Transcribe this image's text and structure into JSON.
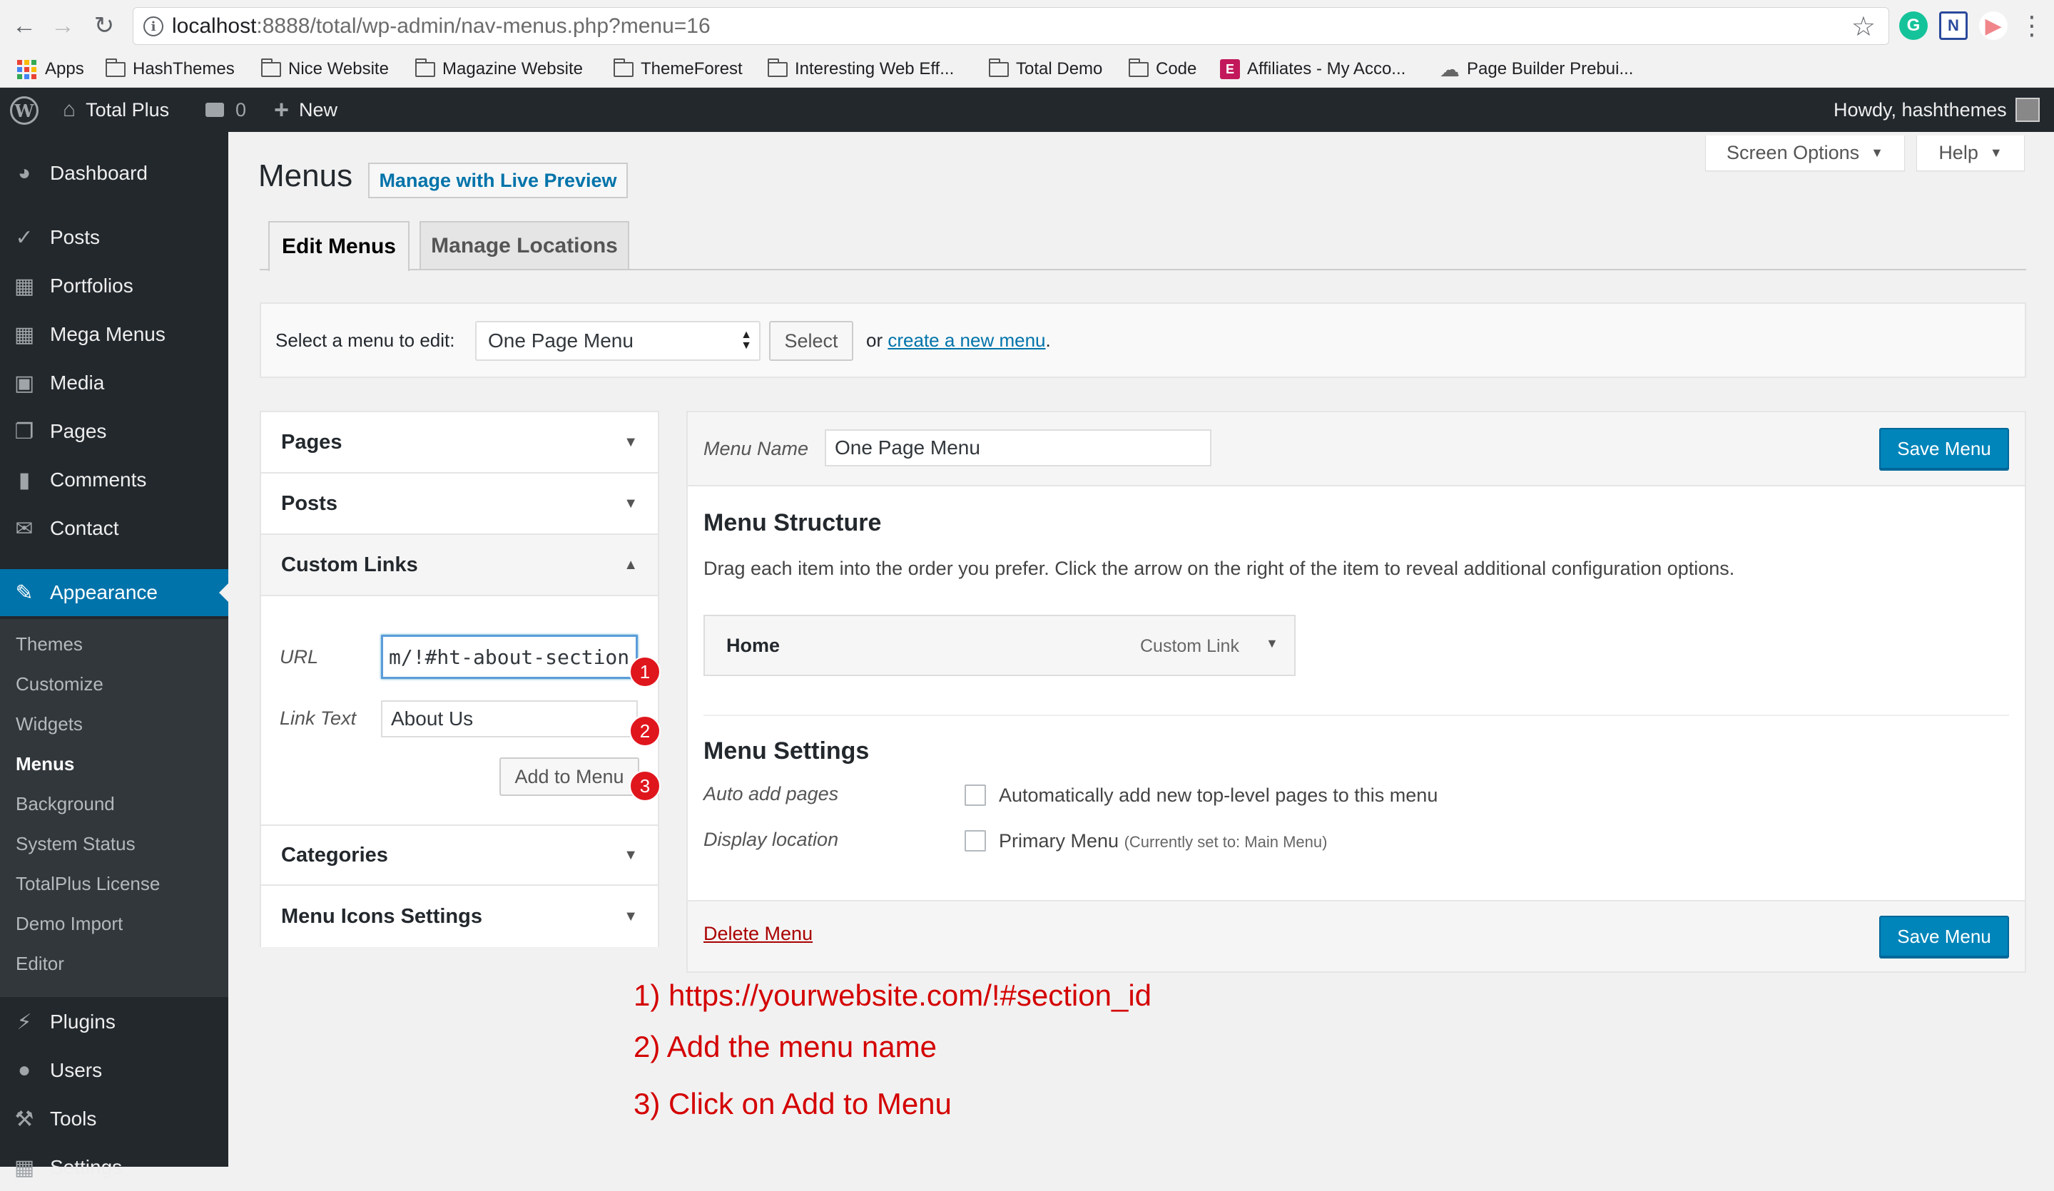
{
  "browser": {
    "url_host": "localhost",
    "url_rest": ":8888/total/wp-admin/nav-menus.php?menu=16",
    "bookmarks": [
      "Apps",
      "HashThemes",
      "Nice Website",
      "Magazine Website",
      "ThemeForest",
      "Interesting Web Eff...",
      "Total Demo",
      "Code",
      "Affiliates - My Acco...",
      "Page Builder Prebui..."
    ]
  },
  "adminbar": {
    "site_name": "Total Plus",
    "comments_count": "0",
    "new_label": "New",
    "howdy": "Howdy, hashthemes"
  },
  "sidebar": {
    "items": [
      "Dashboard",
      "Posts",
      "Portfolios",
      "Mega Menus",
      "Media",
      "Pages",
      "Comments",
      "Contact",
      "Appearance",
      "Plugins",
      "Users",
      "Tools",
      "Settings"
    ],
    "submenu": [
      "Themes",
      "Customize",
      "Widgets",
      "Menus",
      "Background",
      "System Status",
      "TotalPlus License",
      "Demo Import",
      "Editor"
    ]
  },
  "header": {
    "title": "Menus",
    "live_preview": "Manage with Live Preview",
    "screen_options": "Screen Options",
    "help": "Help"
  },
  "tabs": [
    "Edit Menus",
    "Manage Locations"
  ],
  "manage": {
    "label": "Select a menu to edit:",
    "selected": "One Page Menu",
    "select_button": "Select",
    "or_text": "or",
    "create_link": "create a new menu",
    "period": "."
  },
  "accordion": {
    "sections": [
      "Pages",
      "Posts",
      "Custom Links",
      "Categories",
      "Menu Icons Settings"
    ],
    "url_label": "URL",
    "url_value": "m/!#ht-about-section",
    "link_text_label": "Link Text",
    "link_text_value": "About Us",
    "add_button": "Add to Menu",
    "badges": [
      "1",
      "2",
      "3"
    ]
  },
  "menu": {
    "name_label": "Menu Name",
    "name_value": "One Page Menu",
    "save_label": "Save Menu",
    "structure_title": "Menu Structure",
    "structure_desc": "Drag each item into the order you prefer. Click the arrow on the right of the item to reveal additional configuration options.",
    "item_title": "Home",
    "item_type": "Custom Link",
    "settings_title": "Menu Settings",
    "auto_add_label": "Auto add pages",
    "auto_add_text": "Automatically add new top-level pages to this menu",
    "display_label": "Display location",
    "primary_text": "Primary Menu",
    "primary_note": "(Currently set to: Main Menu)",
    "delete_label": "Delete Menu"
  },
  "annotations": [
    "1) https://yourwebsite.com/!#section_id",
    "2) Add the menu name",
    "3) Click on Add to Menu"
  ],
  "colors": {
    "admin_dark": "#23282d",
    "accent": "#0073aa",
    "primary_button": "#0085ba",
    "annotation_red": "#d40000"
  }
}
